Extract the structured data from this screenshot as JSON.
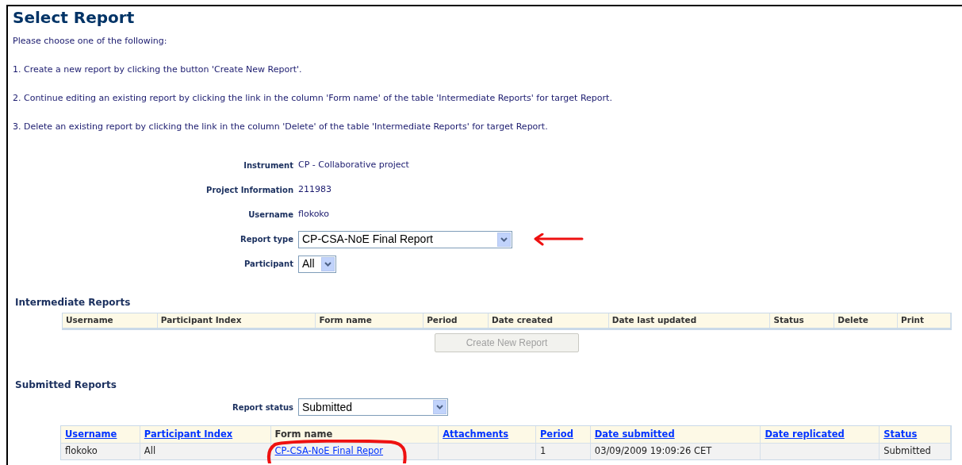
{
  "title": "Select Report",
  "instructions": [
    "Please choose one of the following:",
    "1. Create a new report by clicking the button 'Create New Report'.",
    "2. Continue editing an existing report by clicking the link in the column 'Form name' of the table 'Intermediate Reports' for target Report.",
    "3. Delete an existing report by clicking the link in the column 'Delete' of the table 'Intermediate Reports' for target Report."
  ],
  "info": [
    {
      "kind": "text",
      "label": "Instrument",
      "value": "CP - Collaborative project"
    },
    {
      "kind": "text",
      "label": "Project Information",
      "value": "211983"
    },
    {
      "kind": "text",
      "label": "Username",
      "value": "flokoko"
    },
    {
      "kind": "select",
      "label": "Report type",
      "value": "CP-CSA-NoE Final Report",
      "annotated": true
    },
    {
      "kind": "select",
      "label": "Participant",
      "value": "All"
    }
  ],
  "intermediate": {
    "title": "Intermediate Reports",
    "columns": [
      "Username",
      "Participant Index",
      "Form name",
      "Period",
      "Date created",
      "Date last updated",
      "Status",
      "Delete",
      "Print"
    ],
    "button": {
      "label": "Create New Report",
      "disabled": true
    }
  },
  "submitted": {
    "title": "Submitted Reports",
    "filter": {
      "label": "Report status",
      "value": "Submitted"
    },
    "columns": [
      {
        "label": "Username",
        "sortable": true
      },
      {
        "label": "Participant Index",
        "sortable": true
      },
      {
        "label": "Form name",
        "sortable": false
      },
      {
        "label": "Attachments",
        "sortable": true
      },
      {
        "label": "Period",
        "sortable": true
      },
      {
        "label": "Date submitted",
        "sortable": true
      },
      {
        "label": "Date replicated",
        "sortable": true
      },
      {
        "label": "Status",
        "sortable": true
      }
    ],
    "rows": [
      [
        {
          "text": "flokoko",
          "link": false
        },
        {
          "text": "All",
          "link": false
        },
        {
          "text": "CP-CSA-NoE Final Repor",
          "link": true,
          "annotated": true
        },
        null,
        {
          "text": "1",
          "link": false
        },
        {
          "text": "03/09/2009 19:09:26 CET",
          "link": false
        },
        null,
        {
          "text": "Submitted",
          "link": false
        }
      ]
    ]
  }
}
